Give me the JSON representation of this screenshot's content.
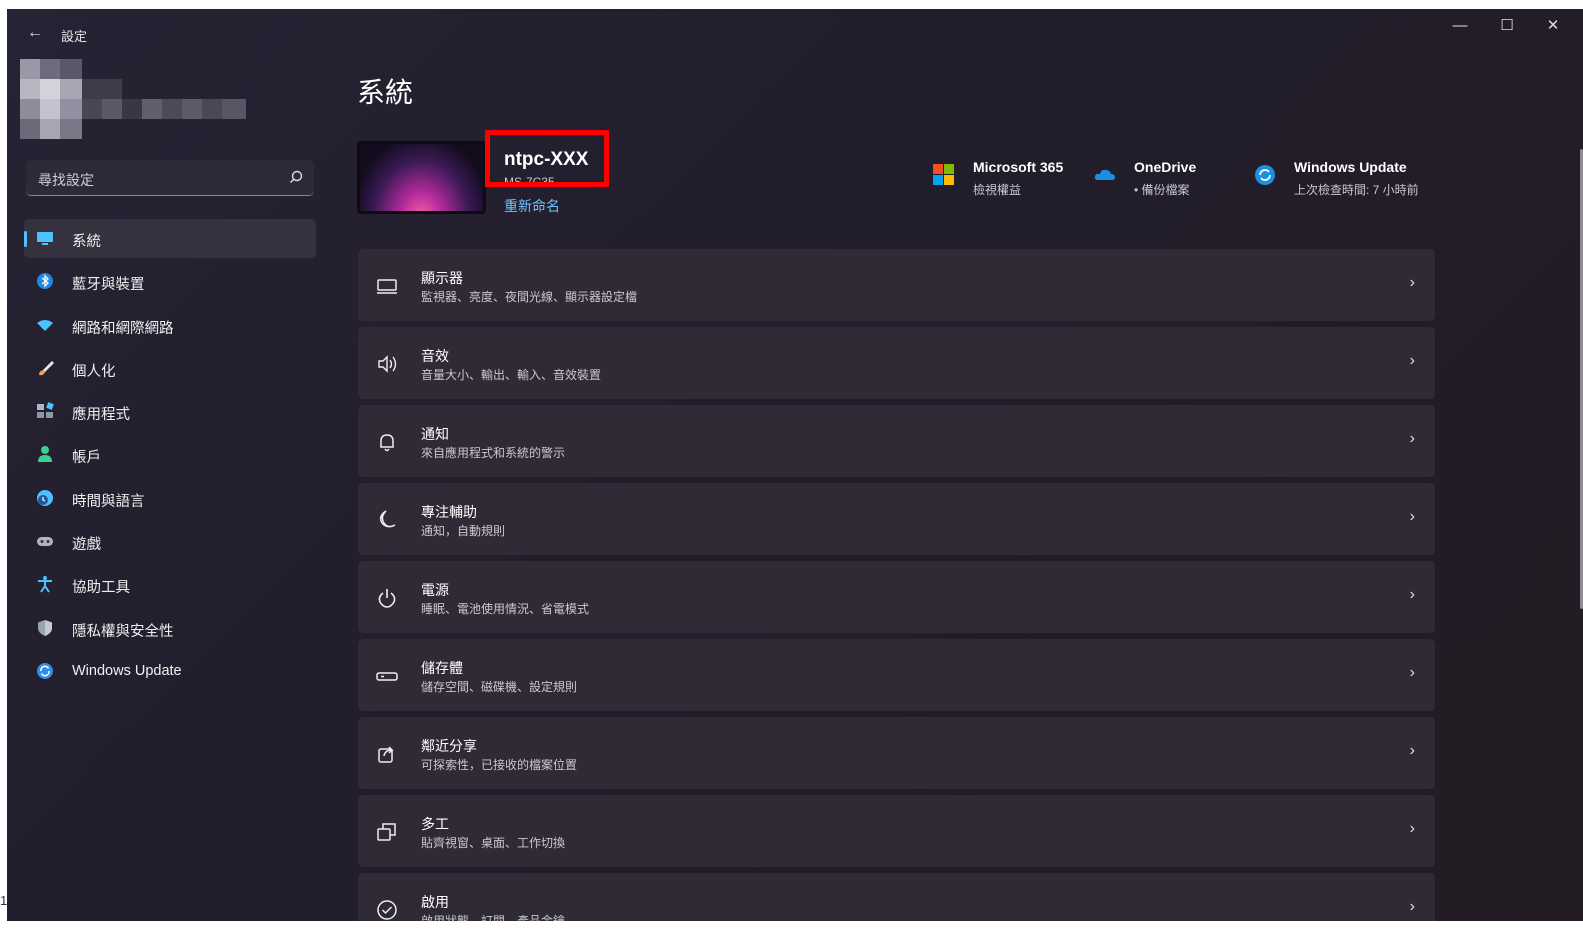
{
  "window": {
    "app_title": "設定",
    "back": "←",
    "minimize": "—",
    "maximize": "☐",
    "close": "✕"
  },
  "search": {
    "placeholder": "尋找設定"
  },
  "sidebar": {
    "items": [
      {
        "label": "系統",
        "icon": "monitor-icon",
        "color": "#4cc2ff",
        "selected": true
      },
      {
        "label": "藍牙與裝置",
        "icon": "bluetooth-icon",
        "color": "#1e88e5"
      },
      {
        "label": "網路和網際網路",
        "icon": "wifi-icon",
        "color": "#4cc2ff"
      },
      {
        "label": "個人化",
        "icon": "brush-icon",
        "color": "#f0b070"
      },
      {
        "label": "應用程式",
        "icon": "apps-icon",
        "color": "#a9b8c8"
      },
      {
        "label": "帳戶",
        "icon": "person-icon",
        "color": "#3ecf8e"
      },
      {
        "label": "時間與語言",
        "icon": "globe-clock-icon",
        "color": "#4cc2ff"
      },
      {
        "label": "遊戲",
        "icon": "gamepad-icon",
        "color": "#b0b4bc"
      },
      {
        "label": "協助工具",
        "icon": "accessibility-icon",
        "color": "#4cc2ff"
      },
      {
        "label": "隱私權與安全性",
        "icon": "shield-icon",
        "color": "#9aa3ad"
      },
      {
        "label": "Windows Update",
        "icon": "update-icon",
        "color": "#2e8ee8"
      }
    ]
  },
  "main": {
    "page_title": "系統",
    "device": {
      "name": "ntpc-XXX",
      "model": "MS-7C35",
      "rename": "重新命名"
    },
    "quick_links": [
      {
        "title": "Microsoft 365",
        "subtitle": "檢視權益",
        "icon": "microsoft-logo-icon"
      },
      {
        "title": "OneDrive",
        "subtitle": "• 備份檔案",
        "icon": "cloud-icon"
      },
      {
        "title": "Windows Update",
        "subtitle": "上次檢查時間: 7 小時前",
        "icon": "update-icon"
      }
    ],
    "cards": [
      {
        "title": "顯示器",
        "subtitle": "監視器、亮度、夜間光線、顯示器設定檔",
        "icon": "display-icon"
      },
      {
        "title": "音效",
        "subtitle": "音量大小、輸出、輸入、音效裝置",
        "icon": "speaker-icon"
      },
      {
        "title": "通知",
        "subtitle": "來自應用程式和系統的警示",
        "icon": "bell-icon"
      },
      {
        "title": "專注輔助",
        "subtitle": "通知，自動規則",
        "icon": "moon-icon"
      },
      {
        "title": "電源",
        "subtitle": "睡眠、電池使用情況、省電模式",
        "icon": "power-icon"
      },
      {
        "title": "儲存體",
        "subtitle": "儲存空間、磁碟機、設定規則",
        "icon": "storage-icon"
      },
      {
        "title": "鄰近分享",
        "subtitle": "可探索性，已接收的檔案位置",
        "icon": "share-icon"
      },
      {
        "title": "多工",
        "subtitle": "貼齊視窗、桌面、工作切換",
        "icon": "multitask-icon"
      },
      {
        "title": "啟用",
        "subtitle": "啟用狀態、訂閱、產品金鑰",
        "icon": "check-circle-icon"
      }
    ],
    "chevron": "›"
  },
  "edge_text": "1"
}
